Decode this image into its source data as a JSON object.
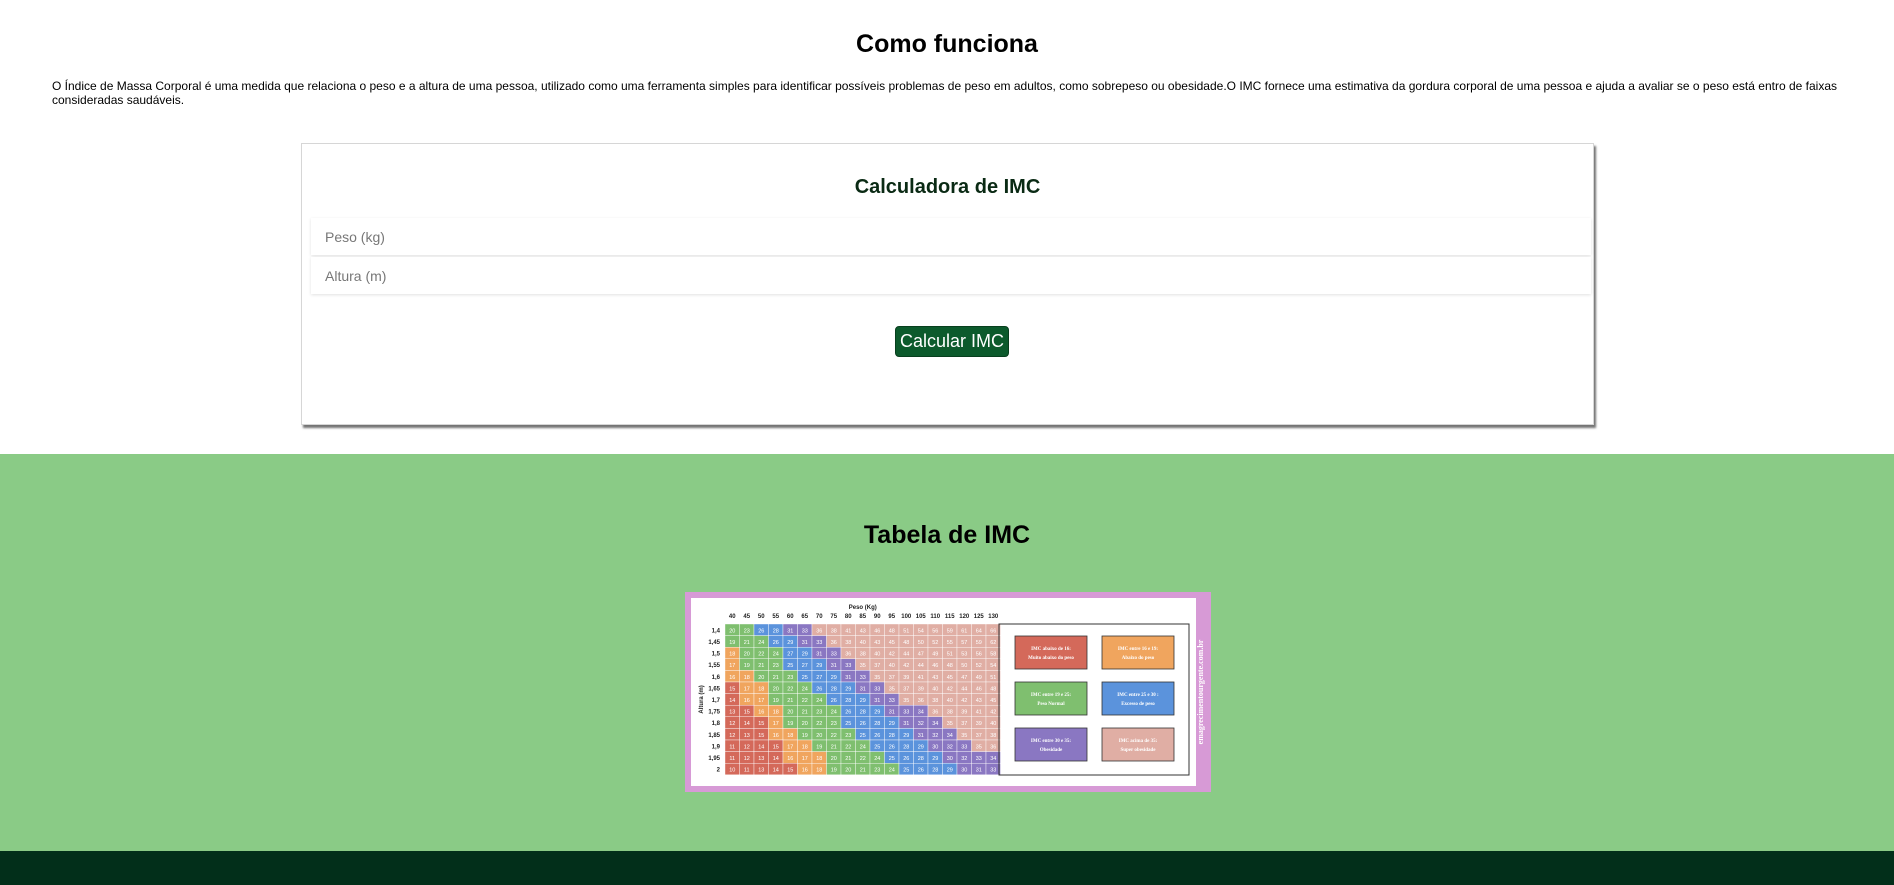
{
  "how": {
    "title": "Como funciona",
    "text": "O Índice de Massa Corporal é uma medida que relaciona o peso e a altura de uma pessoa, utilizado como uma ferramenta simples para identificar possíveis problemas de peso em adultos, como sobrepeso ou obesidade.O IMC fornece uma estimativa da gordura corporal de uma pessoa e ajuda a avaliar se o peso está entro de faixas consideradas saudáveis."
  },
  "calculator": {
    "title": "Calculadora de IMC",
    "peso_placeholder": "Peso (kg)",
    "altura_placeholder": "Altura (m)",
    "button_label": "Calcular IMC"
  },
  "tabela": {
    "title": "Tabela de IMC",
    "image": {
      "peso_label": "Peso (Kg)",
      "altura_label": "Altura (m)",
      "weights": [
        "40",
        "45",
        "50",
        "55",
        "60",
        "65",
        "70",
        "75",
        "80",
        "85",
        "90",
        "95",
        "100",
        "105",
        "110",
        "115",
        "120",
        "125",
        "130"
      ],
      "heights": [
        "1,4",
        "1,45",
        "1,5",
        "1,55",
        "1,6",
        "1,65",
        "1,7",
        "1,75",
        "1,8",
        "1,85",
        "1,9",
        "1,95",
        "2"
      ],
      "watermark": "emagrecimentourgente.com.br",
      "legend": [
        {
          "line1": "IMC abaixo de 16:",
          "line2": "Muito abaixo do peso",
          "color": "#d4695a"
        },
        {
          "line1": "IMC entre 16 e 19:",
          "line2": "Abaixo do peso",
          "color": "#f0a55e"
        },
        {
          "line1": "IMC entre 19 e 25:",
          "line2": "Peso Normal",
          "color": "#7fbf6f"
        },
        {
          "line1": "IMC entre 25 e 30 :",
          "line2": "Excesso de peso",
          "color": "#5b93dc"
        },
        {
          "line1": "IMC entre 30 e 35:",
          "line2": "Obesidade",
          "color": "#8a77c2"
        },
        {
          "line1": "IMC acima de 35:",
          "line2": "Super obesidade",
          "color": "#e0aea4"
        }
      ]
    }
  },
  "colors": {
    "accent_green": "#0c5a2c",
    "section_green": "#8acb86",
    "footer": "#022f1a",
    "image_border": "#d79ad6"
  }
}
